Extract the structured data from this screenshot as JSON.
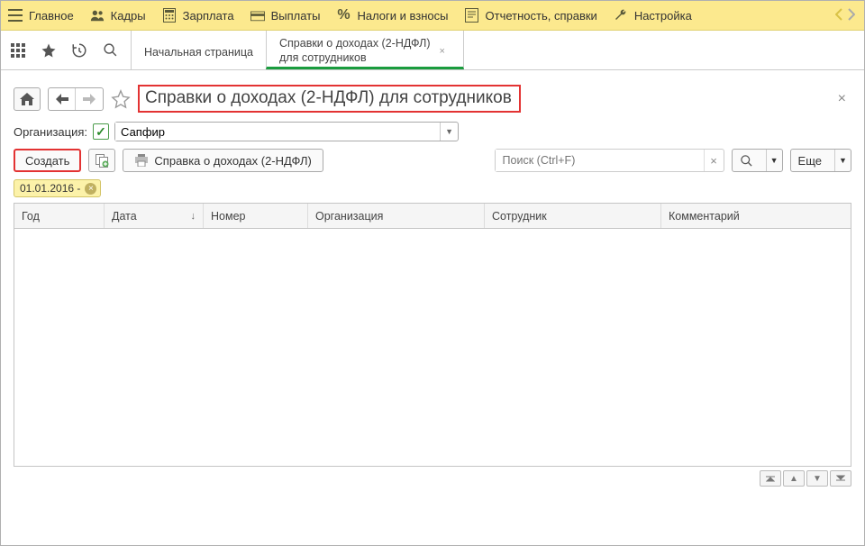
{
  "menu": {
    "items": [
      {
        "label": "Главное",
        "icon": "menu"
      },
      {
        "label": "Кадры",
        "icon": "people"
      },
      {
        "label": "Зарплата",
        "icon": "calc"
      },
      {
        "label": "Выплаты",
        "icon": "folder"
      },
      {
        "label": "Налоги и взносы",
        "icon": "percent"
      },
      {
        "label": "Отчетность, справки",
        "icon": "report"
      },
      {
        "label": "Настройка",
        "icon": "wrench"
      }
    ]
  },
  "tabs": {
    "start": "Начальная страница",
    "active": "Справки о доходах (2-НДФЛ)\nдля сотрудников"
  },
  "page": {
    "title": "Справки о доходах (2-НДФЛ) для сотрудников"
  },
  "filter": {
    "org_label": "Организация:",
    "org_value": "Сапфир"
  },
  "actions": {
    "create": "Создать",
    "print_ref": "Справка о доходах (2-НДФЛ)",
    "search_placeholder": "Поиск (Ctrl+F)",
    "more": "Еще"
  },
  "date_tag": "01.01.2016 -",
  "columns": {
    "year": "Год",
    "date": "Дата",
    "number": "Номер",
    "org": "Организация",
    "employee": "Сотрудник",
    "comment": "Комментарий"
  }
}
